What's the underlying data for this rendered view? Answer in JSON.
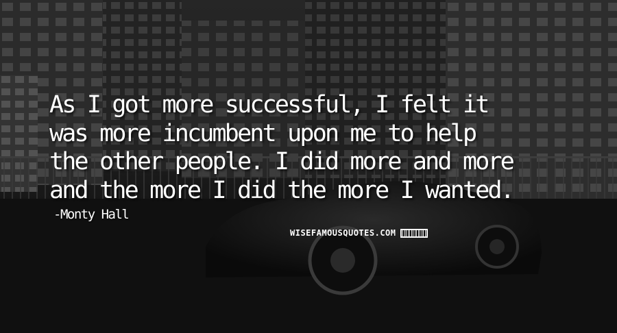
{
  "quote": {
    "lines": [
      "As I got more successful, I felt it",
      "was more incumbent upon me to help",
      "the other people. I did more and more",
      "and the more I did the more I wanted."
    ]
  },
  "author": "Monty Hall",
  "watermark": "WISEFAMOUSQUOTES.COM",
  "colors": {
    "text": "#ffffff",
    "background": "#1c1c1c"
  }
}
